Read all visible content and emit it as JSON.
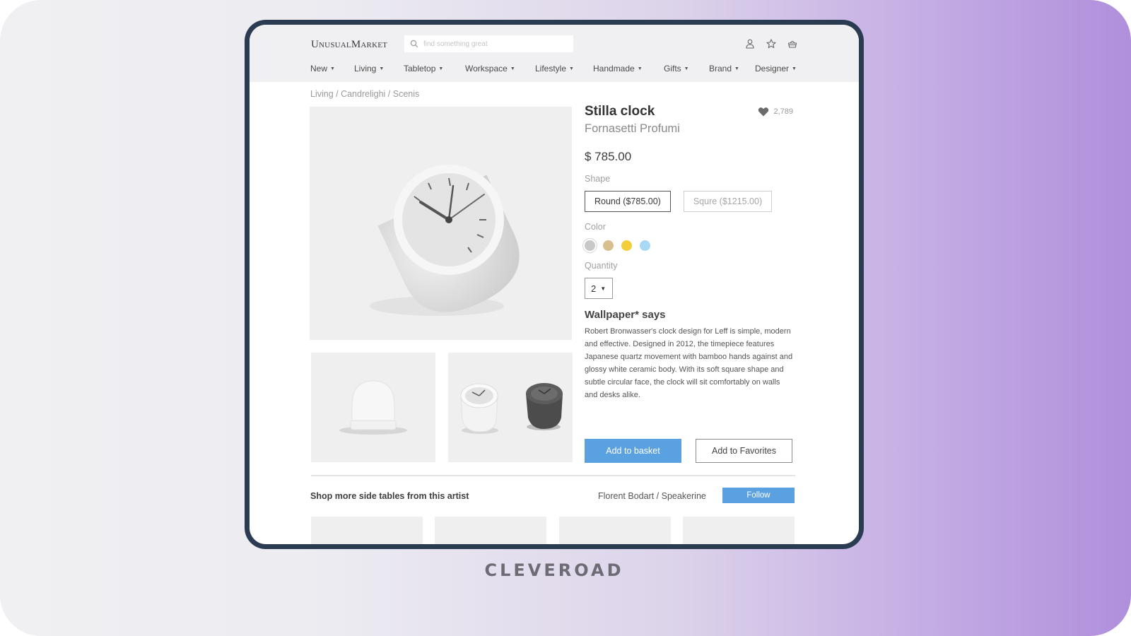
{
  "header": {
    "logo": "UnusualMarket",
    "search_placeholder": "find something great",
    "icons": [
      "user-icon",
      "star-icon",
      "basket-icon"
    ]
  },
  "nav": [
    {
      "label": "New"
    },
    {
      "label": "Living"
    },
    {
      "label": "Tabletop"
    },
    {
      "label": "Workspace"
    },
    {
      "label": "Lifestyle"
    },
    {
      "label": "Handmade"
    },
    {
      "label": "Gifts"
    },
    {
      "label": "Brand"
    },
    {
      "label": "Designer"
    }
  ],
  "breadcrumb": "Living / Candrelighi / Scenis",
  "product": {
    "title": "Stilla clock",
    "brand": "Fornasetti Profumi",
    "likes": "2,789",
    "price": "$ 785.00",
    "shape_label": "Shape",
    "shapes": [
      {
        "label": "Round ($785.00)",
        "selected": true
      },
      {
        "label": "Squre ($1215.00)",
        "selected": false
      }
    ],
    "color_label": "Color",
    "colors": [
      {
        "name": "gray",
        "hex": "#c8c8c8",
        "selected": true
      },
      {
        "name": "beige",
        "hex": "#d8bf8e",
        "selected": false
      },
      {
        "name": "yellow",
        "hex": "#f2cf3a",
        "selected": false
      },
      {
        "name": "light-blue",
        "hex": "#a7d9f4",
        "selected": false
      }
    ],
    "quantity_label": "Quantity",
    "quantity": "2",
    "review_title": "Wallpaper* says",
    "review_text": "Robert Bronwasser's clock design for Leff is simple, modern and effective. Designed in 2012, the timepiece features Japanese quartz movement with bamboo hands against and glossy white ceramic body. With its soft square shape and subtle circular face, the clock will sit comfortably on walls and desks alike.",
    "add_to_basket": "Add to basket",
    "add_to_favorites": "Add to Favorites"
  },
  "more": {
    "title": "Shop more side tables from this artist",
    "artist": "Florent Bodart / Speakerine",
    "follow": "Follow",
    "card_count": 4
  },
  "colors": {
    "accent": "#5aa1e2",
    "frame": "#2b3b52",
    "header_bg": "#f0f0f2"
  },
  "watermark": "CLEVEROAD"
}
